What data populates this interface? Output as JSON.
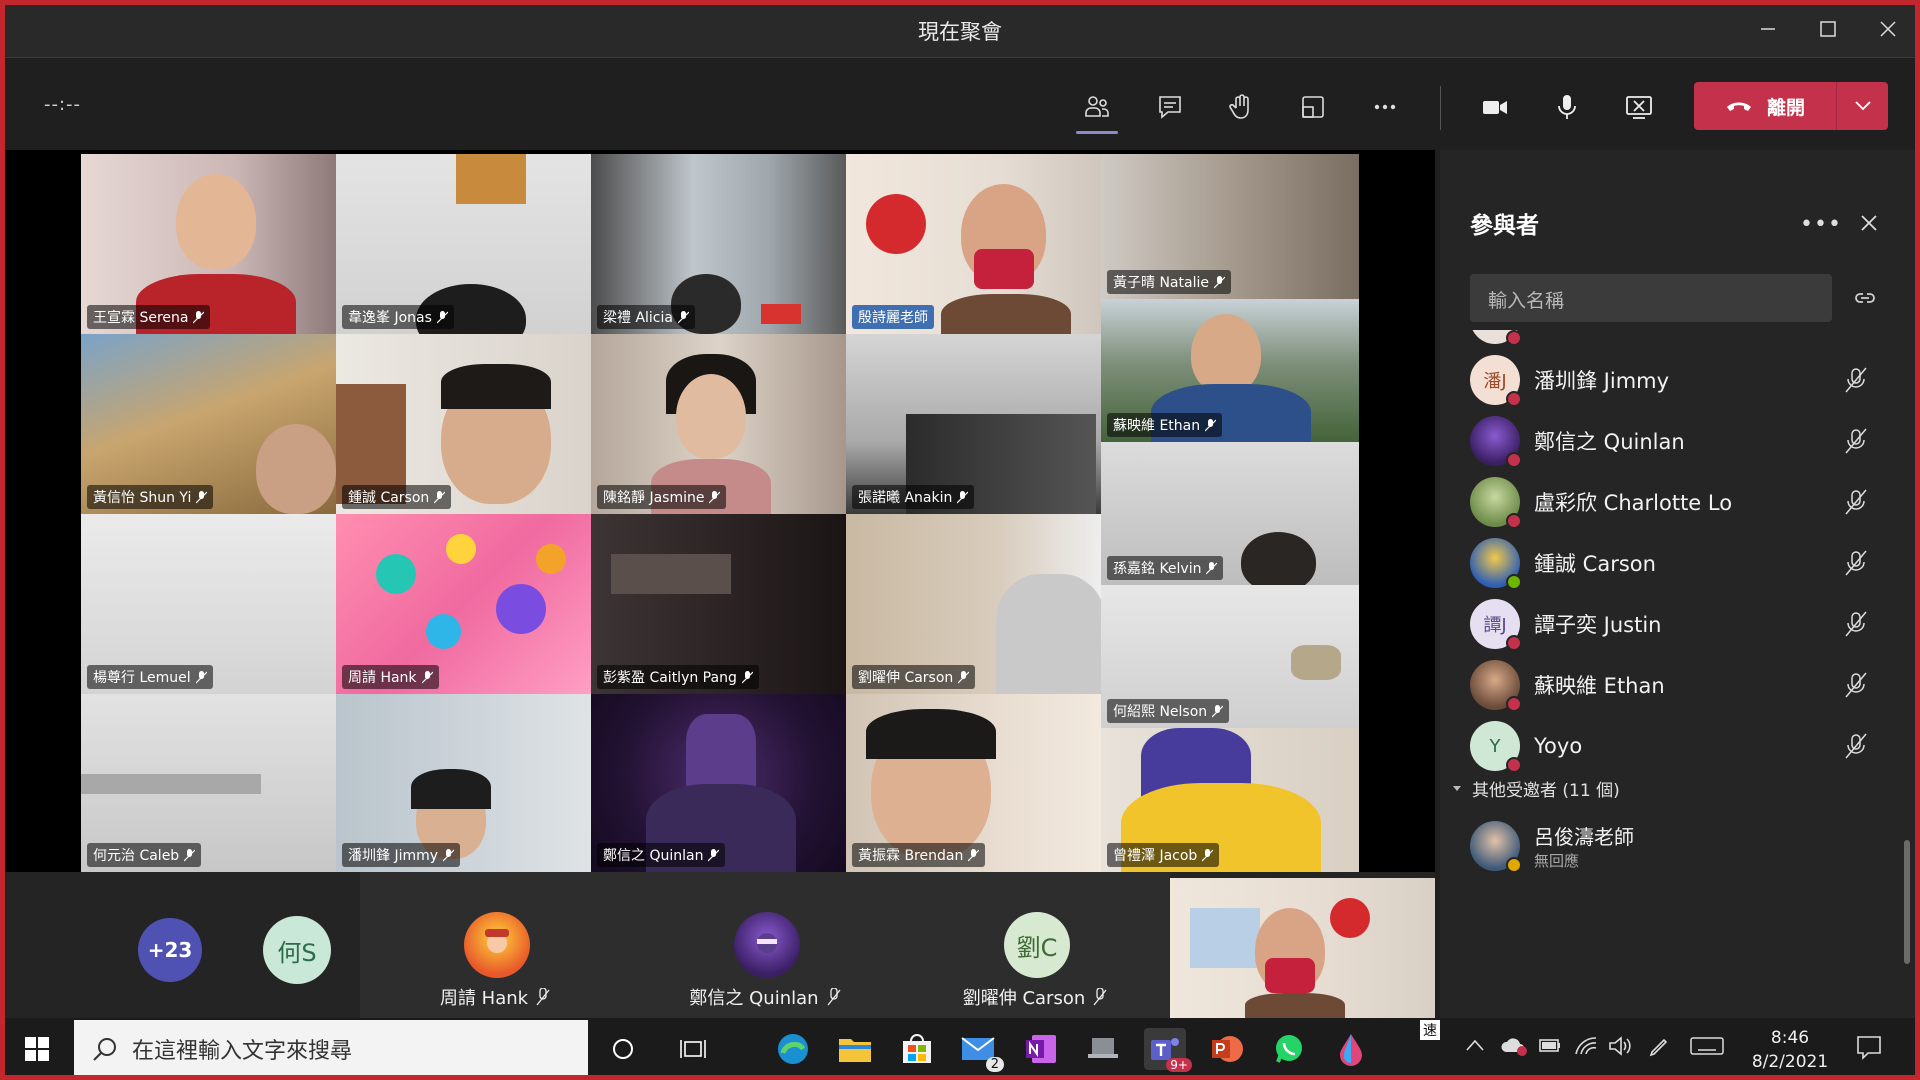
{
  "window": {
    "title": "現在聚會"
  },
  "toolbar": {
    "timer": "--:--",
    "leave_label": "離開"
  },
  "grid": [
    {
      "name": "王宣霖 Serena"
    },
    {
      "name": "韋逸峯 Jonas"
    },
    {
      "name": "梁禮 Alicia"
    },
    {
      "name": "殷詩麗老師"
    },
    {
      "name": "黃子晴 Natalie"
    },
    {
      "name": "黃信怡 Shun Yi"
    },
    {
      "name": "鍾誠 Carson"
    },
    {
      "name": "陳銘靜 Jasmine"
    },
    {
      "name": "張諾曦 Anakin"
    },
    {
      "name": "蘇映維 Ethan"
    },
    {
      "name": "楊尊行 Lemuel"
    },
    {
      "name": "周請 Hank"
    },
    {
      "name": "彭紫盈 Caitlyn Pang"
    },
    {
      "name": "劉曜伸 Carson"
    },
    {
      "name": "孫嘉銘 Kelvin"
    },
    {
      "name": "何元治 Caleb"
    },
    {
      "name": "潘圳鋒 Jimmy"
    },
    {
      "name": "鄭信之 Quinlan"
    },
    {
      "name": "黃振霖 Brendan"
    },
    {
      "name": "何紹熙 Nelson"
    },
    {
      "name": "曾禮澤 Jacob"
    }
  ],
  "strip": {
    "overflow": "+23",
    "he_initials": "何S",
    "hank": "周請 Hank",
    "quinlan": "鄭信之 Quinlan",
    "carson_initials": "劉C",
    "carson": "劉曜伸 Carson"
  },
  "panel": {
    "title": "參與者",
    "search_placeholder": "輸入名稱",
    "participants": [
      {
        "name": "潘圳鋒 Jimmy",
        "initials": "潘J"
      },
      {
        "name": "鄭信之 Quinlan",
        "initials": ""
      },
      {
        "name": "盧彩欣 Charlotte Lo",
        "initials": ""
      },
      {
        "name": "鍾誠 Carson",
        "initials": ""
      },
      {
        "name": "譚子奕 Justin",
        "initials": "譚J"
      },
      {
        "name": "蘇映維 Ethan",
        "initials": ""
      },
      {
        "name": "Yoyo",
        "initials": "Y"
      }
    ],
    "others_header": "其他受邀者 (11 個)",
    "invitee": {
      "name": "呂俊濤老師",
      "status": "無回應"
    }
  },
  "taskbar": {
    "search_placeholder": "在這裡輸入文字來搜尋",
    "mail_badge": "2",
    "teams_badge": "9+",
    "ime": "速",
    "time": "8:46",
    "date": "8/2/2021"
  }
}
